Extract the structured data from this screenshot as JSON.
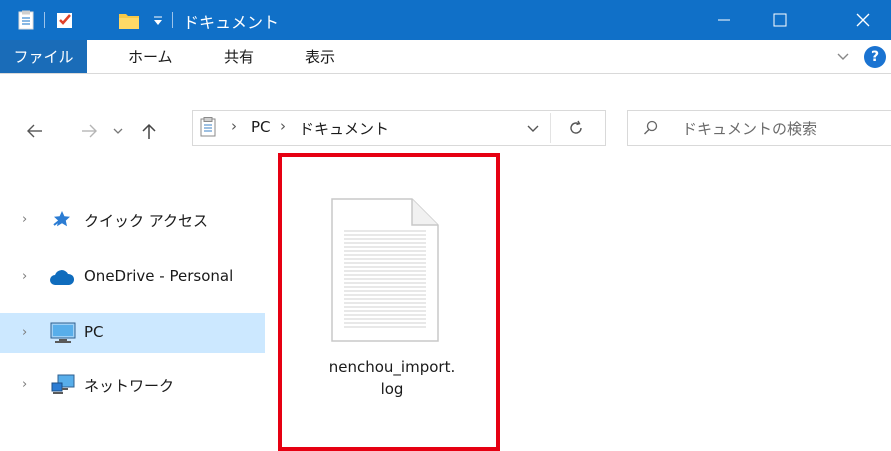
{
  "window": {
    "title": "ドキュメント",
    "title_bar_color": "#1070c8",
    "buttons": [
      "minimize",
      "maximize",
      "close"
    ]
  },
  "quick_access_toolbar": {
    "icons": [
      "properties-icon",
      "check-icon",
      "new-folder-icon",
      "customize-dropdown-icon"
    ]
  },
  "ribbon": {
    "tabs": [
      {
        "label": "ファイル",
        "active": true
      },
      {
        "label": "ホーム"
      },
      {
        "label": "共有"
      },
      {
        "label": "表示"
      }
    ],
    "help_label": "?"
  },
  "address": {
    "path": [
      {
        "label": "PC"
      },
      {
        "label": "ドキュメント"
      }
    ],
    "separator": "›"
  },
  "search": {
    "placeholder": "ドキュメントの検索"
  },
  "navigation": {
    "items": [
      {
        "label": "クイック アクセス",
        "icon": "quick-access-star-icon",
        "selected": false
      },
      {
        "label": "OneDrive - Personal",
        "icon": "onedrive-cloud-icon",
        "selected": false
      },
      {
        "label": "PC",
        "icon": "pc-monitor-icon",
        "selected": true
      },
      {
        "label": "ネットワーク",
        "icon": "network-icon",
        "selected": false
      }
    ]
  },
  "files": [
    {
      "name_line1": "nenchou_import.",
      "name_line2": "log",
      "icon": "text-file-icon"
    }
  ],
  "highlight": {
    "color": "#e60012"
  }
}
